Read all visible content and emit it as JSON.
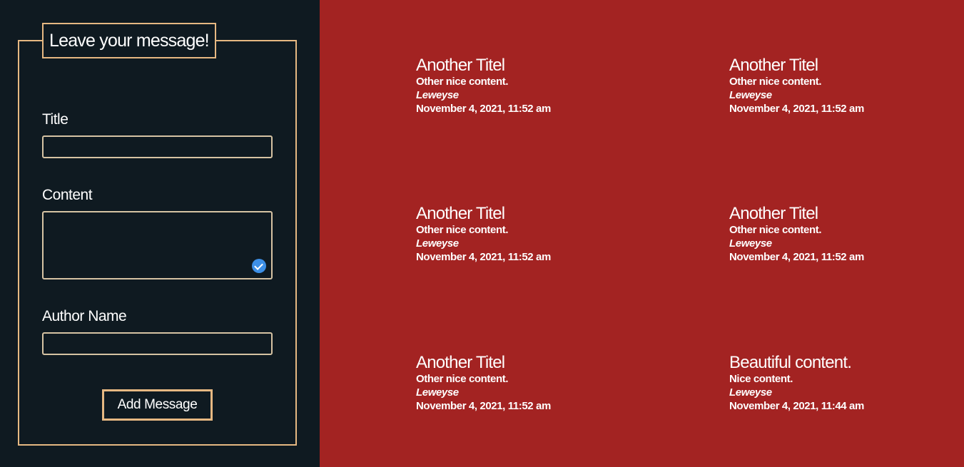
{
  "form": {
    "legend": "Leave your message!",
    "title_label": "Title",
    "title_value": "",
    "content_label": "Content",
    "content_value": "",
    "author_label": "Author Name",
    "author_value": "",
    "submit_label": "Add Message"
  },
  "messages": [
    {
      "title": "Another Titel",
      "content": "Other nice content.",
      "author": "Leweyse",
      "date": "November 4, 2021, 11:52 am"
    },
    {
      "title": "Another Titel",
      "content": "Other nice content.",
      "author": "Leweyse",
      "date": "November 4, 2021, 11:52 am"
    },
    {
      "title": "Another Titel",
      "content": "Other nice content.",
      "author": "Leweyse",
      "date": "November 4, 2021, 11:52 am"
    },
    {
      "title": "Another Titel",
      "content": "Other nice content.",
      "author": "Leweyse",
      "date": "November 4, 2021, 11:52 am"
    },
    {
      "title": "Another Titel",
      "content": "Other nice content.",
      "author": "Leweyse",
      "date": "November 4, 2021, 11:52 am"
    },
    {
      "title": "Beautiful content.",
      "content": "Nice content.",
      "author": "Leweyse",
      "date": "November 4, 2021, 11:44 am"
    }
  ],
  "colors": {
    "form_bg": "#0f1a21",
    "accent_border": "#e6b882",
    "messages_bg": "#a32322",
    "check_icon": "#3d8fe6"
  }
}
